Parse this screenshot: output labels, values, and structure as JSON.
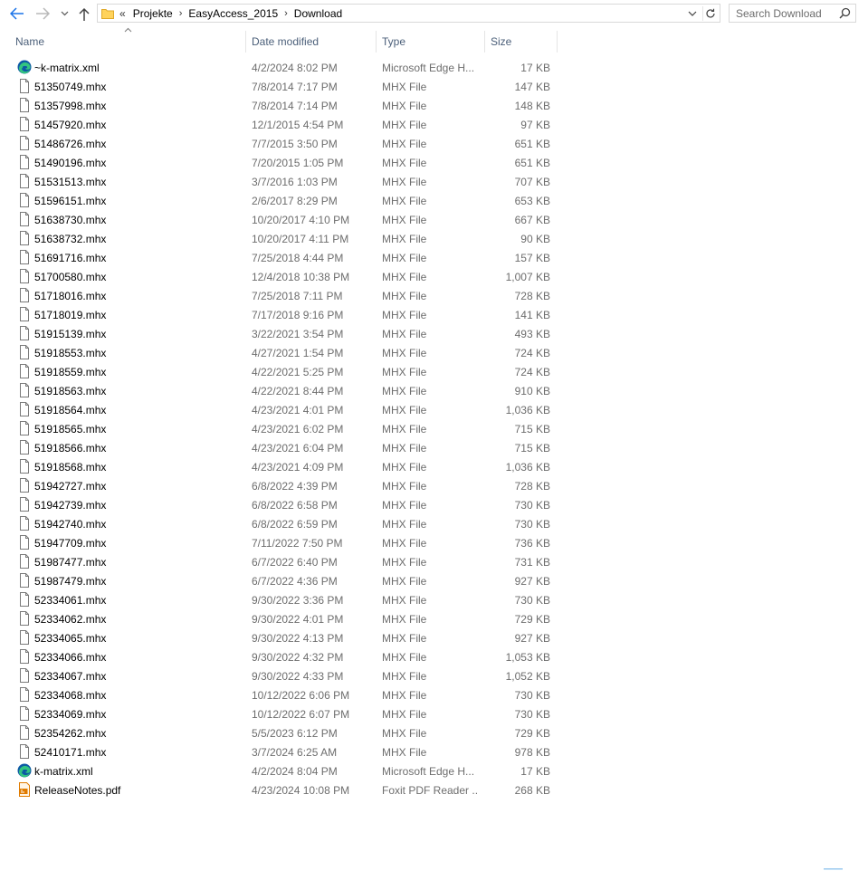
{
  "nav": {
    "back_icon": "arrow-left-icon",
    "forward_icon": "arrow-right-icon",
    "recent_icon": "chevron-down-icon",
    "up_icon": "arrow-up-icon",
    "accent": "#1a73e8"
  },
  "address": {
    "overflow": "«",
    "crumbs": [
      "Projekte",
      "EasyAccess_2015",
      "Download"
    ],
    "separator": "›"
  },
  "search": {
    "placeholder": "Search Download"
  },
  "columns": {
    "name": "Name",
    "date": "Date modified",
    "type": "Type",
    "size": "Size"
  },
  "files": [
    {
      "name": "~k-matrix.xml",
      "date": "4/2/2024 8:02 PM",
      "type": "Microsoft Edge H...",
      "size": "17 KB",
      "icon": "edge"
    },
    {
      "name": "51350749.mhx",
      "date": "7/8/2014 7:17 PM",
      "type": "MHX File",
      "size": "147 KB",
      "icon": "file"
    },
    {
      "name": "51357998.mhx",
      "date": "7/8/2014 7:14 PM",
      "type": "MHX File",
      "size": "148 KB",
      "icon": "file"
    },
    {
      "name": "51457920.mhx",
      "date": "12/1/2015 4:54 PM",
      "type": "MHX File",
      "size": "97 KB",
      "icon": "file"
    },
    {
      "name": "51486726.mhx",
      "date": "7/7/2015 3:50 PM",
      "type": "MHX File",
      "size": "651 KB",
      "icon": "file"
    },
    {
      "name": "51490196.mhx",
      "date": "7/20/2015 1:05 PM",
      "type": "MHX File",
      "size": "651 KB",
      "icon": "file"
    },
    {
      "name": "51531513.mhx",
      "date": "3/7/2016 1:03 PM",
      "type": "MHX File",
      "size": "707 KB",
      "icon": "file"
    },
    {
      "name": "51596151.mhx",
      "date": "2/6/2017 8:29 PM",
      "type": "MHX File",
      "size": "653 KB",
      "icon": "file"
    },
    {
      "name": "51638730.mhx",
      "date": "10/20/2017 4:10 PM",
      "type": "MHX File",
      "size": "667 KB",
      "icon": "file"
    },
    {
      "name": "51638732.mhx",
      "date": "10/20/2017 4:11 PM",
      "type": "MHX File",
      "size": "90 KB",
      "icon": "file"
    },
    {
      "name": "51691716.mhx",
      "date": "7/25/2018 4:44 PM",
      "type": "MHX File",
      "size": "157 KB",
      "icon": "file"
    },
    {
      "name": "51700580.mhx",
      "date": "12/4/2018 10:38 PM",
      "type": "MHX File",
      "size": "1,007 KB",
      "icon": "file"
    },
    {
      "name": "51718016.mhx",
      "date": "7/25/2018 7:11 PM",
      "type": "MHX File",
      "size": "728 KB",
      "icon": "file"
    },
    {
      "name": "51718019.mhx",
      "date": "7/17/2018 9:16 PM",
      "type": "MHX File",
      "size": "141 KB",
      "icon": "file"
    },
    {
      "name": "51915139.mhx",
      "date": "3/22/2021 3:54 PM",
      "type": "MHX File",
      "size": "493 KB",
      "icon": "file"
    },
    {
      "name": "51918553.mhx",
      "date": "4/27/2021 1:54 PM",
      "type": "MHX File",
      "size": "724 KB",
      "icon": "file"
    },
    {
      "name": "51918559.mhx",
      "date": "4/22/2021 5:25 PM",
      "type": "MHX File",
      "size": "724 KB",
      "icon": "file"
    },
    {
      "name": "51918563.mhx",
      "date": "4/22/2021 8:44 PM",
      "type": "MHX File",
      "size": "910 KB",
      "icon": "file"
    },
    {
      "name": "51918564.mhx",
      "date": "4/23/2021 4:01 PM",
      "type": "MHX File",
      "size": "1,036 KB",
      "icon": "file"
    },
    {
      "name": "51918565.mhx",
      "date": "4/23/2021 6:02 PM",
      "type": "MHX File",
      "size": "715 KB",
      "icon": "file"
    },
    {
      "name": "51918566.mhx",
      "date": "4/23/2021 6:04 PM",
      "type": "MHX File",
      "size": "715 KB",
      "icon": "file"
    },
    {
      "name": "51918568.mhx",
      "date": "4/23/2021 4:09 PM",
      "type": "MHX File",
      "size": "1,036 KB",
      "icon": "file"
    },
    {
      "name": "51942727.mhx",
      "date": "6/8/2022 4:39 PM",
      "type": "MHX File",
      "size": "728 KB",
      "icon": "file"
    },
    {
      "name": "51942739.mhx",
      "date": "6/8/2022 6:58 PM",
      "type": "MHX File",
      "size": "730 KB",
      "icon": "file"
    },
    {
      "name": "51942740.mhx",
      "date": "6/8/2022 6:59 PM",
      "type": "MHX File",
      "size": "730 KB",
      "icon": "file"
    },
    {
      "name": "51947709.mhx",
      "date": "7/11/2022 7:50 PM",
      "type": "MHX File",
      "size": "736 KB",
      "icon": "file"
    },
    {
      "name": "51987477.mhx",
      "date": "6/7/2022 6:40 PM",
      "type": "MHX File",
      "size": "731 KB",
      "icon": "file"
    },
    {
      "name": "51987479.mhx",
      "date": "6/7/2022 4:36 PM",
      "type": "MHX File",
      "size": "927 KB",
      "icon": "file"
    },
    {
      "name": "52334061.mhx",
      "date": "9/30/2022 3:36 PM",
      "type": "MHX File",
      "size": "730 KB",
      "icon": "file"
    },
    {
      "name": "52334062.mhx",
      "date": "9/30/2022 4:01 PM",
      "type": "MHX File",
      "size": "729 KB",
      "icon": "file"
    },
    {
      "name": "52334065.mhx",
      "date": "9/30/2022 4:13 PM",
      "type": "MHX File",
      "size": "927 KB",
      "icon": "file"
    },
    {
      "name": "52334066.mhx",
      "date": "9/30/2022 4:32 PM",
      "type": "MHX File",
      "size": "1,053 KB",
      "icon": "file"
    },
    {
      "name": "52334067.mhx",
      "date": "9/30/2022 4:33 PM",
      "type": "MHX File",
      "size": "1,052 KB",
      "icon": "file"
    },
    {
      "name": "52334068.mhx",
      "date": "10/12/2022 6:06 PM",
      "type": "MHX File",
      "size": "730 KB",
      "icon": "file"
    },
    {
      "name": "52334069.mhx",
      "date": "10/12/2022 6:07 PM",
      "type": "MHX File",
      "size": "730 KB",
      "icon": "file"
    },
    {
      "name": "52354262.mhx",
      "date": "5/5/2023 6:12 PM",
      "type": "MHX File",
      "size": "729 KB",
      "icon": "file"
    },
    {
      "name": "52410171.mhx",
      "date": "3/7/2024 6:25 AM",
      "type": "MHX File",
      "size": "978 KB",
      "icon": "file"
    },
    {
      "name": "k-matrix.xml",
      "date": "4/2/2024 8:04 PM",
      "type": "Microsoft Edge H...",
      "size": "17 KB",
      "icon": "edge"
    },
    {
      "name": "ReleaseNotes.pdf",
      "date": "4/23/2024 10:08 PM",
      "type": "Foxit PDF Reader ...",
      "size": "268 KB",
      "icon": "pdf"
    }
  ]
}
